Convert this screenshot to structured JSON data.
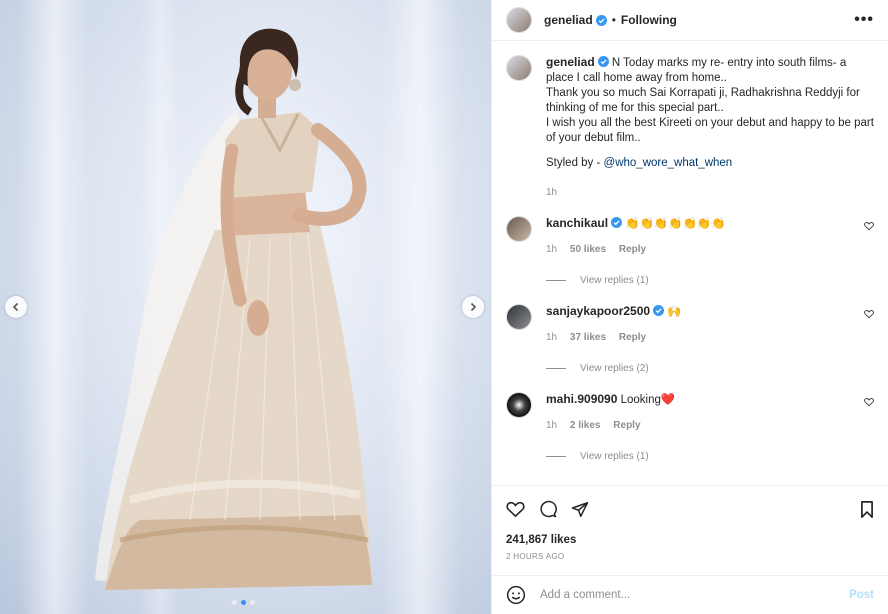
{
  "post": {
    "username": "geneliad",
    "follow_status": "Following",
    "separator": "•",
    "more": "•••"
  },
  "caption": {
    "username": "geneliad",
    "lines": [
      "N Today marks my re- entry into south films- a place I call home away from home..",
      "Thank you so much Sai Korrapati ji, Radhakrishna Reddyji for thinking of me for this special part..",
      "I wish you all the best Kireeti on your debut and happy to be part of your debut film.."
    ],
    "styled_by_label": "Styled by -",
    "styled_by_handle": "@who_wore_what_when",
    "time": "1h"
  },
  "comments": [
    {
      "username": "kanchikaul",
      "verified": true,
      "text": "👏👏👏👏👏👏👏",
      "time": "1h",
      "likes": "50 likes",
      "reply": "Reply",
      "view_replies": "View replies (1)"
    },
    {
      "username": "sanjaykapoor2500",
      "verified": true,
      "text": "🙌",
      "time": "1h",
      "likes": "37 likes",
      "reply": "Reply",
      "view_replies": "View replies (2)"
    },
    {
      "username": "mahi.909090",
      "verified": false,
      "text": "Looking❤️",
      "time": "1h",
      "likes": "2 likes",
      "reply": "Reply",
      "view_replies": "View replies (1)"
    }
  ],
  "engagement": {
    "likes": "241,867 likes",
    "posted": "2 HOURS AGO"
  },
  "add_comment": {
    "placeholder": "Add a comment...",
    "post_label": "Post"
  },
  "carousel": {
    "slide_count": 3,
    "active_index": 1
  },
  "colors": {
    "verified": "#3897f0",
    "link": "#00376b",
    "muted": "#8e8e8e",
    "post_button": "#b2dffc"
  }
}
